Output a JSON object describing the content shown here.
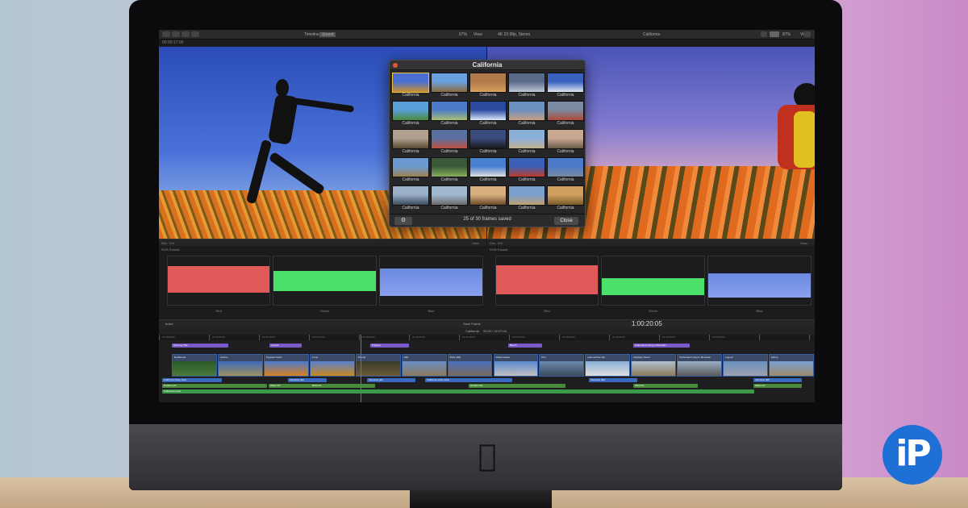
{
  "app": {
    "project_name": "California"
  },
  "toolbar": {
    "timecode_left": "00:00:17:00",
    "timeline_label": "Timeline",
    "timeline_tab": "Sound",
    "zoom_left": "67%",
    "view_left": "View",
    "format": "4K 23.98p, Stereo",
    "clip_name": "California",
    "zoom_right": "87%",
    "view_right": "View"
  },
  "viewer_left": {
    "label": "Rec. 709",
    "view": "View"
  },
  "viewer_right": {
    "label": "Rec. 709",
    "view": "View"
  },
  "scopes_left": {
    "title": "RGB Parade",
    "channels": [
      "Red",
      "Green",
      "Blue"
    ]
  },
  "scopes_right": {
    "title": "RGB Parade",
    "channels": [
      "Red",
      "Green",
      "Blue"
    ]
  },
  "dialog": {
    "title": "California",
    "thumbnail_label": "California",
    "status": "25 of 30 frames saved",
    "close_label": "Close",
    "thumb_colors": [
      [
        "#4a6fd0",
        "#c89030"
      ],
      [
        "#6aa0e0",
        "#8a6a3a"
      ],
      [
        "#b07a4a",
        "#d8a060"
      ],
      [
        "#5a6a8a",
        "#c0c8d8"
      ],
      [
        "#3a60c0",
        "#e0e8f0"
      ],
      [
        "#5aa0d8",
        "#4a8a3a"
      ],
      [
        "#4a7ac8",
        "#a8c070"
      ],
      [
        "#2a4aa0",
        "#d8e8f8"
      ],
      [
        "#6a90c0",
        "#c8a080"
      ],
      [
        "#7a8aa0",
        "#b04a3a"
      ],
      [
        "#b0a090",
        "#5a4a30"
      ],
      [
        "#5a70a0",
        "#c05040"
      ],
      [
        "#3a4a7a",
        "#1a1a1a"
      ],
      [
        "#8ab0d8",
        "#c0b090"
      ],
      [
        "#c8a890",
        "#6a5a4a"
      ],
      [
        "#6a9ad0",
        "#a08050"
      ],
      [
        "#3a5a3a",
        "#8ab05a"
      ],
      [
        "#4a80d0",
        "#e0e0e0"
      ],
      [
        "#3a60b8",
        "#c03a2a"
      ],
      [
        "#4a7ac8",
        "#7a8aa0"
      ],
      [
        "#9ab0c8",
        "#3a4a5a"
      ],
      [
        "#a0b8d0",
        "#6a6a6a"
      ],
      [
        "#d8b080",
        "#6a4a2a"
      ],
      [
        "#7aa0d0",
        "#c0a070"
      ],
      [
        "#d0a060",
        "#7a5a2a"
      ]
    ]
  },
  "timeline": {
    "index_label": "Index",
    "clip_name": "California",
    "duration": "05:20 / 02:47:04",
    "save_frame": "Save Frame",
    "timecode": "1:00:20:05",
    "ruler": [
      "01:00:00:00",
      "01:00:05:00",
      "01:00:10:00",
      "01:00:15:00",
      "01:00:20:00",
      "01:00:25:00",
      "01:00:30:00",
      "01:00:35:00",
      "01:00:40:00",
      "01:00:45:00",
      "01:00:50:00",
      "01:00:55:00"
    ],
    "titles": [
      {
        "label": "Opening Title",
        "color": "#7a5ac8"
      },
      {
        "label": "Cactus",
        "color": "#7a5ac8"
      },
      {
        "label": "Poppies",
        "color": "#7a5ac8"
      },
      {
        "label": "Beach",
        "color": "#7a5ac8"
      },
      {
        "label": "Sutherland Canyon Mountain",
        "color": "#7a5ac8"
      }
    ],
    "clips": [
      {
        "label": "Redwoods",
        "c1": "#2a5a2a",
        "c2": "#4a7a3a"
      },
      {
        "label": "Cactus",
        "c1": "#3a6ab8",
        "c2": "#a09060"
      },
      {
        "label": "Poppies Fields",
        "c1": "#4a7ad0",
        "c2": "#d8801e"
      },
      {
        "label": "Jump",
        "c1": "#5a80d0",
        "c2": "#c8881e"
      },
      {
        "label": "Woods",
        "c1": "#3a3a2a",
        "c2": "#6a5a3a"
      },
      {
        "label": "Hills",
        "c1": "#6a90c8",
        "c2": "#8a7a5a"
      },
      {
        "label": "Rock cliffs",
        "c1": "#4a70c0",
        "c2": "#7a6a5a"
      },
      {
        "label": "Rollercoaster",
        "c1": "#5a8ad0",
        "c2": "#c0c0c0"
      },
      {
        "label": "Pier",
        "c1": "#6a8ab0",
        "c2": "#3a4a5a"
      },
      {
        "label": "park archive clip",
        "c1": "#8ab0d8",
        "c2": "#e0e0e0"
      },
      {
        "label": "Highway Street",
        "c1": "#b0c0d0",
        "c2": "#8a7a5a"
      },
      {
        "label": "Sutherland Canyon Mountain",
        "c1": "#9ab0c8",
        "c2": "#5a5a5a"
      },
      {
        "label": "Lagoon",
        "c1": "#6a90c0",
        "c2": "#a0a0b0"
      },
      {
        "label": "Hiking",
        "c1": "#7aa0d0",
        "c2": "#9a8a6a"
      }
    ],
    "audio_tracks": [
      {
        "label": "California Voice Over",
        "color": "#3a6ac0"
      },
      {
        "label": "Interview p00",
        "color": "#3a6ac0"
      },
      {
        "label": "Interview p04",
        "color": "#3a6ac0"
      },
      {
        "label": "California Voice Over",
        "color": "#3a6ac0"
      },
      {
        "label": "Interview p03",
        "color": "#3a6ac0"
      },
      {
        "label": "Interview p05",
        "color": "#3a6ac0"
      },
      {
        "label": "Outdoor.sfx",
        "color": "#4a8a3a"
      },
      {
        "label": "Water.sfx",
        "color": "#4a8a3a"
      },
      {
        "label": "Birds.sfx",
        "color": "#4a8a3a"
      },
      {
        "label": "Outdoor.sfx",
        "color": "#4a8a3a"
      },
      {
        "label": "Wind.sfx",
        "color": "#4a8a3a"
      },
      {
        "label": "Water.sfx",
        "color": "#4a8a3a"
      },
      {
        "label": "California music",
        "color": "#3a9a4a"
      }
    ]
  },
  "branding": {
    "logo_text": "iP"
  }
}
